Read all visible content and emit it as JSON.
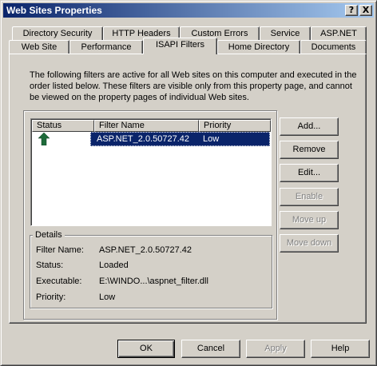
{
  "window": {
    "title": "Web Sites Properties",
    "help_glyph": "?",
    "close_glyph": "X"
  },
  "tabs": {
    "row_back": [
      "Directory Security",
      "HTTP Headers",
      "Custom Errors",
      "Service",
      "ASP.NET"
    ],
    "row_front": [
      "Web Site",
      "Performance",
      "ISAPI Filters",
      "Home Directory",
      "Documents"
    ],
    "active": "ISAPI Filters"
  },
  "isapi": {
    "description": "The following filters are active for all Web sites on this computer and executed in the order listed below. These filters are visible only from this property page, and cannot be viewed on the property pages of individual Web sites.",
    "columns": [
      "Status",
      "Filter Name",
      "Priority"
    ],
    "rows": [
      {
        "status_icon": "green-up-arrow-icon",
        "name": "ASP.NET_2.0.50727.42",
        "priority": "Low",
        "selected": true
      }
    ],
    "details": {
      "label": "Details",
      "filter_name_label": "Filter Name:",
      "filter_name_value": "ASP.NET_2.0.50727.42",
      "status_label": "Status:",
      "status_value": "Loaded",
      "executable_label": "Executable:",
      "executable_value": "E:\\WINDO...\\aspnet_filter.dll",
      "priority_label": "Priority:",
      "priority_value": "Low"
    },
    "buttons": {
      "add": "Add...",
      "remove": "Remove",
      "edit": "Edit...",
      "enable": "Enable",
      "move_up": "Move up",
      "move_down": "Move down"
    }
  },
  "footer": {
    "ok": "OK",
    "cancel": "Cancel",
    "apply": "Apply",
    "help": "Help"
  },
  "colors": {
    "title_gradient_start": "#0a246a",
    "title_gradient_end": "#a6caf0",
    "selection": "#0a246a",
    "status_arrow": "#1e6b3a",
    "face": "#d4d0c8"
  }
}
